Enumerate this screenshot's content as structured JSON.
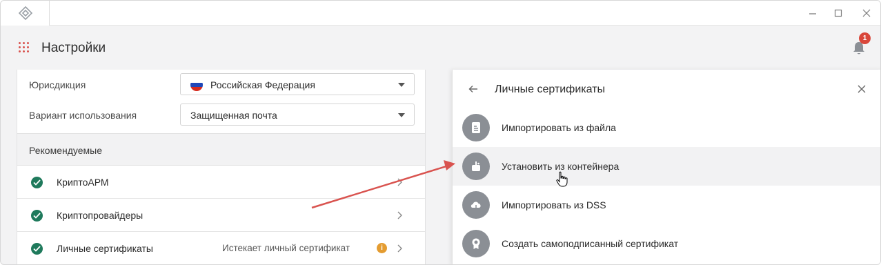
{
  "header": {
    "title": "Настройки",
    "notification_count": "1"
  },
  "form": {
    "jurisdiction": {
      "label": "Юрисдикция",
      "value": "Российская Федерация"
    },
    "usage": {
      "label": "Вариант использования",
      "value": "Защищенная почта"
    }
  },
  "recommended": {
    "title": "Рекомендуемые",
    "items": [
      {
        "label": "КриптоАРМ",
        "status": ""
      },
      {
        "label": "Криптопровайдеры",
        "status": ""
      },
      {
        "label": "Личные сертификаты",
        "status": "Истекает личный сертификат"
      }
    ]
  },
  "certificates_panel": {
    "title": "Личные сертификаты",
    "actions": [
      {
        "label": "Импортировать из файла",
        "icon": "file-icon"
      },
      {
        "label": "Установить из контейнера",
        "icon": "container-icon"
      },
      {
        "label": "Импортировать из DSS",
        "icon": "cloud-download-icon"
      },
      {
        "label": "Создать самоподписанный сертификат",
        "icon": "certificate-icon"
      }
    ]
  },
  "colors": {
    "accent_red": "#d9473b",
    "check_green": "#1f7a5c",
    "warning": "#e49c31",
    "annotation_arrow": "#d9534f"
  }
}
